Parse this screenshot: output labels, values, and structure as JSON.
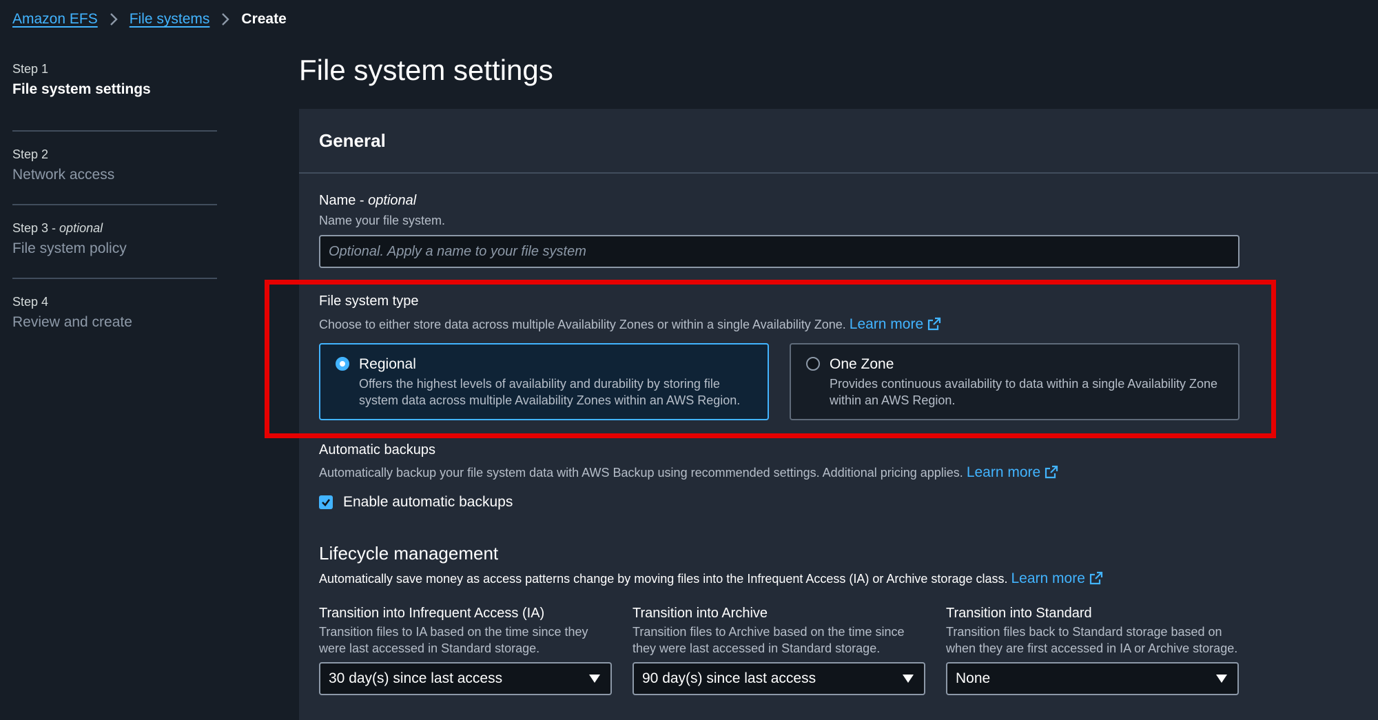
{
  "breadcrumb": {
    "items": [
      "Amazon EFS",
      "File systems"
    ],
    "current": "Create"
  },
  "steps": [
    {
      "num": "Step 1",
      "num_optional": "",
      "title": "File system settings",
      "active": true
    },
    {
      "num": "Step 2",
      "num_optional": "",
      "title": "Network access",
      "active": false
    },
    {
      "num": "Step 3 - ",
      "num_optional": "optional",
      "title": "File system policy",
      "active": false
    },
    {
      "num": "Step 4",
      "num_optional": "",
      "title": "Review and create",
      "active": false
    }
  ],
  "page_title": "File system settings",
  "general": {
    "header": "General",
    "name": {
      "label": "Name - ",
      "label_optional": "optional",
      "description": "Name your file system.",
      "placeholder": "Optional. Apply a name to your file system",
      "value": ""
    },
    "file_system_type": {
      "label": "File system type",
      "description": "Choose to either store data across multiple Availability Zones or within a single Availability Zone.",
      "learn_more": "Learn more",
      "options": [
        {
          "title": "Regional",
          "description": "Offers the highest levels of availability and durability by storing file system data across multiple Availability Zones within an AWS Region.",
          "selected": true
        },
        {
          "title": "One Zone",
          "description": "Provides continuous availability to data within a single Availability Zone within an AWS Region.",
          "selected": false
        }
      ]
    },
    "automatic_backups": {
      "label": "Automatic backups",
      "description": "Automatically backup your file system data with AWS Backup using recommended settings. Additional pricing applies.",
      "learn_more": "Learn more",
      "checkbox_label": "Enable automatic backups",
      "checked": true
    }
  },
  "lifecycle": {
    "title": "Lifecycle management",
    "description": "Automatically save money as access patterns change by moving files into the Infrequent Access (IA) or Archive storage class.",
    "learn_more": "Learn more",
    "columns": [
      {
        "label": "Transition into Infrequent Access (IA)",
        "description": "Transition files to IA based on the time since they were last accessed in Standard storage.",
        "value": "30 day(s) since last access"
      },
      {
        "label": "Transition into Archive",
        "description": "Transition files to Archive based on the time since they were last accessed in Standard storage.",
        "value": "90 day(s) since last access"
      },
      {
        "label": "Transition into Standard",
        "description": "Transition files back to Standard storage based on when they are first accessed in IA or Archive storage.",
        "value": "None"
      }
    ]
  },
  "colors": {
    "background": "#161d26",
    "container": "#232b37",
    "link": "#42b4ff",
    "highlight": "#e60000"
  },
  "icons": [
    "chevron-right-icon",
    "external-link-icon",
    "radio-icon",
    "checkmark-icon",
    "caret-down-icon"
  ]
}
